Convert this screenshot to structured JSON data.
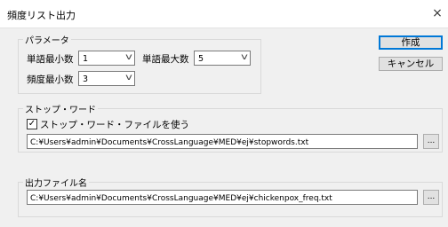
{
  "window": {
    "title": "頻度リスト出力",
    "close_glyph": "×"
  },
  "parameters": {
    "legend": "パラメータ",
    "min_word_count": {
      "label": "単語最小数",
      "value": "1"
    },
    "max_word_count": {
      "label": "単語最大数",
      "value": "5"
    },
    "min_frequency": {
      "label": "頻度最小数",
      "value": "3"
    }
  },
  "buttons": {
    "create": "作成",
    "cancel": "キャンセル",
    "browse": "..."
  },
  "stopwords": {
    "legend": "ストップ・ワード",
    "use_file_label": "ストップ・ワード・ファイルを使う",
    "use_file_checked": true,
    "check_glyph": "✓",
    "path": "C:¥Users¥admin¥Documents¥CrossLanguage¥MED¥ej¥stopwords.txt"
  },
  "output": {
    "legend": "出力ファイル名",
    "path": "C:¥Users¥admin¥Documents¥CrossLanguage¥MED¥ej¥chickenpox_freq.txt"
  },
  "icons": {
    "dropdown": "chevron-down-icon",
    "close": "close-icon",
    "check": "checkmark-icon"
  }
}
